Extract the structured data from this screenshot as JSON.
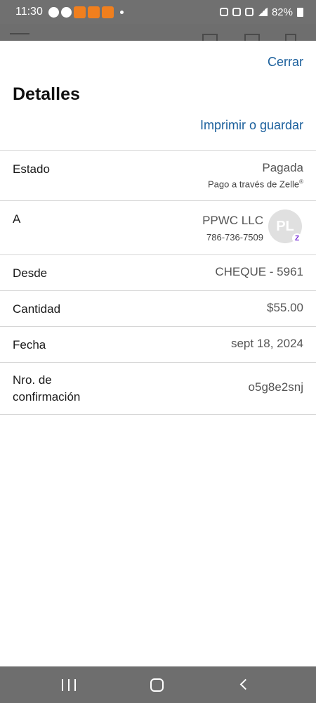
{
  "status_bar": {
    "time": "11:30",
    "battery": "82%"
  },
  "sheet": {
    "close_label": "Cerrar",
    "title": "Detalles",
    "print_label": "Imprimir o guardar"
  },
  "details": {
    "status": {
      "label": "Estado",
      "value": "Pagada",
      "subtext": "Pago a través de Zelle",
      "subtext_mark": "®"
    },
    "to": {
      "label": "A",
      "name": "PPWC LLC",
      "phone": "786-736-7509",
      "avatar_initials": "PL",
      "badge": "Z"
    },
    "from": {
      "label": "Desde",
      "value": "CHEQUE - 5961"
    },
    "amount": {
      "label": "Cantidad",
      "value": "$55.00"
    },
    "date": {
      "label": "Fecha",
      "value": "sept 18, 2024"
    },
    "confirmation": {
      "label_line1": "Nro. de",
      "label_line2": "confirmación",
      "value": "o5g8e2snj"
    }
  },
  "icons": {
    "nav_recent": "recent-apps-icon",
    "nav_home": "home-icon",
    "nav_back": "back-icon",
    "zelle_badge_color": "#6c1cd3",
    "link_color": "#1a5f9c"
  }
}
